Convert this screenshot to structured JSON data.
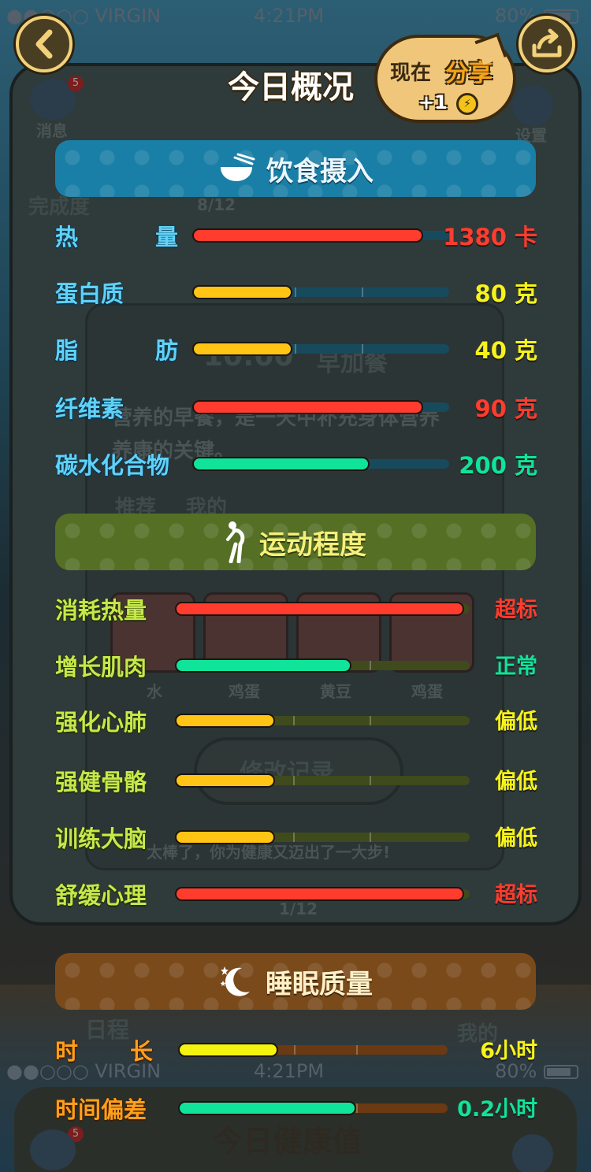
{
  "status_bar": {
    "carrier": "●●○○○ VIRGIN",
    "time": "4:21PM",
    "battery": "80%"
  },
  "header": {
    "title": "今日概况",
    "share_now": "现在",
    "share_word": "分享",
    "share_reward": "+1"
  },
  "background": {
    "badge": "5",
    "messages": "消息",
    "settings": "设置",
    "completion_label": "完成度",
    "completion_value": "8/12",
    "meal_time": "10:00",
    "meal_name": "早加餐",
    "meal_tip": "营养的早餐，是一天中补充身体营养",
    "meal_tip2": "养康的关键。",
    "tab_recommend": "推荐",
    "tab_mine": "我的",
    "foods": [
      "水",
      "鸡蛋",
      "黄豆",
      "鸡蛋"
    ],
    "edit_record": "修改记录",
    "encourage": "太棒了，你为健康又迈出了一大步!",
    "page": "1/12",
    "schedule": "日程",
    "mine": "我的",
    "health_value_title": "今日健康值"
  },
  "colors": {
    "red": "#ff3c2e",
    "yellow": "#ffc414",
    "green": "#10e39a",
    "lemon": "#f4f20f"
  },
  "diet": {
    "title": "饮食摄入",
    "icon": "bowl-icon",
    "items": [
      {
        "label": "热  量",
        "value": "1380 卡",
        "level": 0.9,
        "color": "#ff3c2e",
        "value_color": "#ff3c2e"
      },
      {
        "label": "蛋白质",
        "value": "80 克",
        "level": 0.39,
        "color": "#ffc414",
        "value_color": "#f7f31a"
      },
      {
        "label": "脂  肪",
        "value": "40 克",
        "level": 0.39,
        "color": "#ffc414",
        "value_color": "#f7f31a"
      },
      {
        "label": "纤维素",
        "value": "90 克",
        "level": 0.9,
        "color": "#ff3c2e",
        "value_color": "#ff3c2e"
      },
      {
        "label": "碳水化合物",
        "value": "200 克",
        "level": 0.69,
        "color": "#10e39a",
        "value_color": "#10e39a"
      }
    ]
  },
  "exercise": {
    "title": "运动程度",
    "icon": "stretching-person-icon",
    "items": [
      {
        "label": "消耗热量",
        "value": "超标",
        "level": 0.98,
        "color": "#ff3c2e",
        "value_color": "#ff3c2e"
      },
      {
        "label": "增长肌肉",
        "value": "正常",
        "level": 0.6,
        "color": "#10e39a",
        "value_color": "#10e39a"
      },
      {
        "label": "强化心肺",
        "value": "偏低",
        "level": 0.34,
        "color": "#ffc414",
        "value_color": "#f7f31a"
      },
      {
        "label": "强健骨骼",
        "value": "偏低",
        "level": 0.34,
        "color": "#ffc414",
        "value_color": "#f7f31a"
      },
      {
        "label": "训练大脑",
        "value": "偏低",
        "level": 0.34,
        "color": "#ffc414",
        "value_color": "#f7f31a"
      },
      {
        "label": "舒缓心理",
        "value": "超标",
        "level": 0.98,
        "color": "#ff3c2e",
        "value_color": "#ff3c2e"
      }
    ]
  },
  "sleep": {
    "title": "睡眠质量",
    "icon": "moon-stars-icon",
    "items": [
      {
        "label": "时  长",
        "value": "6小时",
        "level": 0.37,
        "color": "#f4f20f",
        "value_color": "#f7f31a"
      },
      {
        "label": "时间偏差",
        "value": "0.2小时",
        "level": 0.66,
        "color": "#10e39a",
        "value_color": "#10e39a"
      }
    ]
  }
}
